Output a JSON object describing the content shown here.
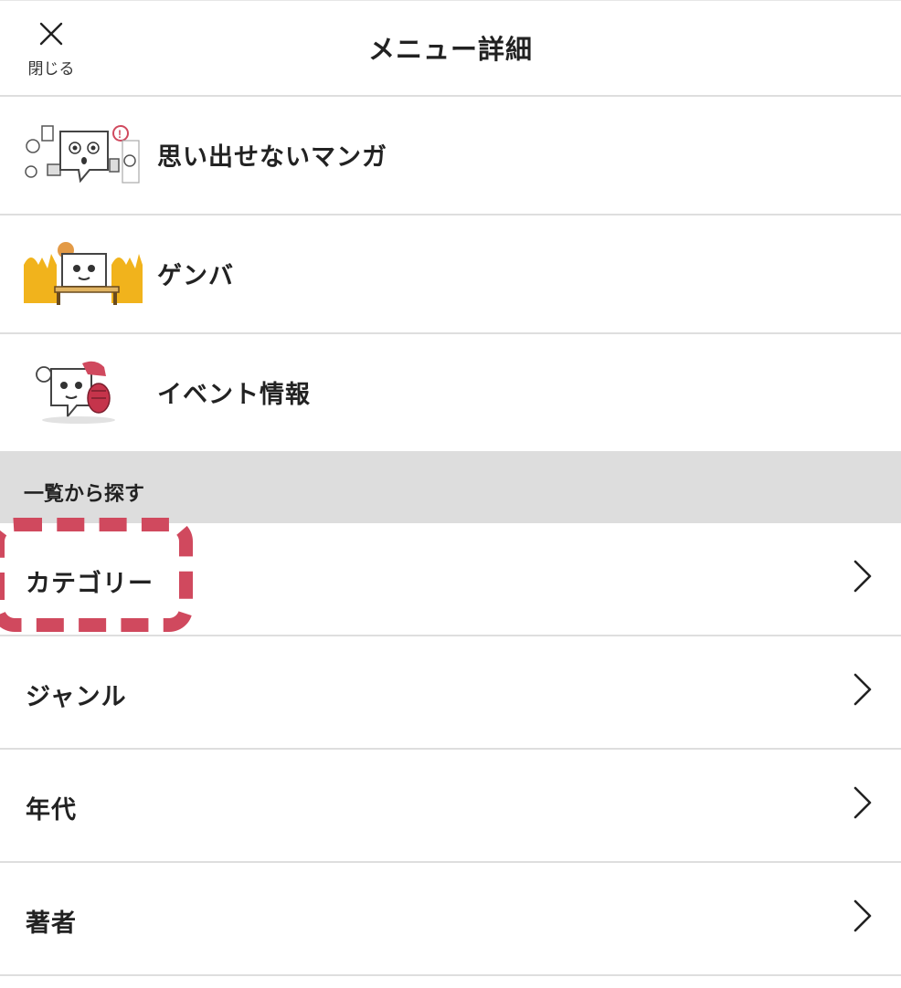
{
  "header": {
    "close_label": "閉じる",
    "title": "メニュー詳細"
  },
  "features": [
    {
      "label": "思い出せないマンガ",
      "icon": "forgotten-manga-illustration"
    },
    {
      "label": "ゲンバ",
      "icon": "genba-illustration"
    },
    {
      "label": "イベント情報",
      "icon": "event-info-illustration"
    }
  ],
  "section": {
    "title": "一覧から探す"
  },
  "nav": [
    {
      "label": "カテゴリー",
      "icon": "chevron-right-icon"
    },
    {
      "label": "ジャンル",
      "icon": "chevron-right-icon"
    },
    {
      "label": "年代",
      "icon": "chevron-right-icon"
    },
    {
      "label": "著者",
      "icon": "chevron-right-icon"
    }
  ],
  "colors": {
    "highlight": "#d0495e",
    "section_bg": "#dddddd",
    "divider": "#dedede",
    "text": "#222222"
  }
}
